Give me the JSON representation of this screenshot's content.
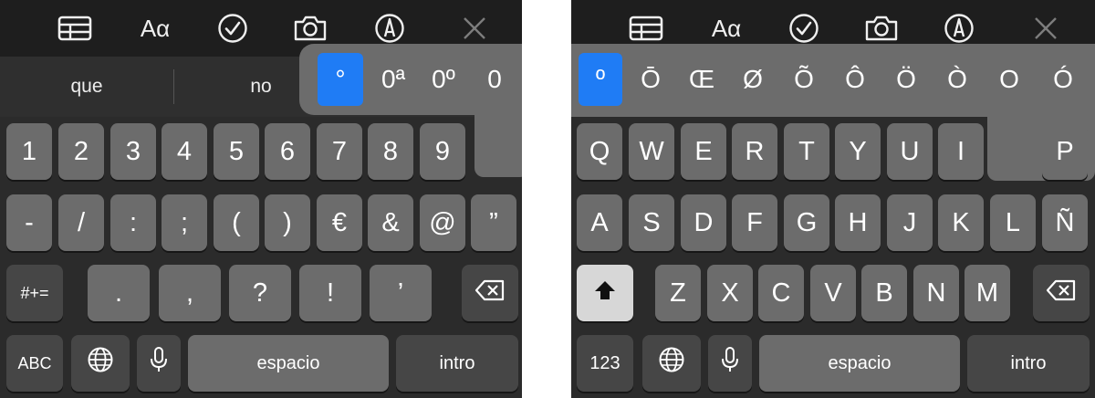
{
  "left": {
    "toolbar": {
      "format_label": "Aα"
    },
    "suggestions": [
      "que",
      "no"
    ],
    "accent_popup": [
      "°",
      "0ª",
      "0º",
      "0"
    ],
    "row1": [
      "1",
      "2",
      "3",
      "4",
      "5",
      "6",
      "7",
      "8",
      "9"
    ],
    "row2": [
      "-",
      "/",
      ":",
      ";",
      "(",
      ")",
      "€",
      "&",
      "@",
      "”"
    ],
    "row3": {
      "mode": "#+=",
      "keys": [
        ".",
        ",",
        "?",
        "!",
        "’"
      ]
    },
    "row4": {
      "abc": "ABC",
      "space": "espacio",
      "enter": "intro"
    }
  },
  "right": {
    "toolbar": {
      "format_label": "Aα"
    },
    "accent_popup": [
      "º",
      "Ō",
      "Œ",
      "Ø",
      "Õ",
      "Ô",
      "Ö",
      "Ò",
      "O",
      "Ó"
    ],
    "row1": [
      "Q",
      "W",
      "E",
      "R",
      "T",
      "Y",
      "U",
      "I",
      "P"
    ],
    "row2": [
      "A",
      "S",
      "D",
      "F",
      "G",
      "H",
      "J",
      "K",
      "L",
      "Ñ"
    ],
    "row3": [
      "Z",
      "X",
      "C",
      "V",
      "B",
      "N",
      "M"
    ],
    "row4": {
      "num": "123",
      "space": "espacio",
      "enter": "intro"
    }
  },
  "colors": {
    "keyboard_bg": "#2b2b2b",
    "key": "#6c6c6c",
    "key_dark": "#464646",
    "selected_accent": "#1f7cf5",
    "shift_active": "#d7d7d7"
  },
  "icons": [
    "table-icon",
    "checkmark-circle-icon",
    "camera-icon",
    "pen-markup-icon",
    "close-icon",
    "globe-icon",
    "microphone-icon",
    "delete-backspace-icon",
    "shift-arrow-icon"
  ]
}
